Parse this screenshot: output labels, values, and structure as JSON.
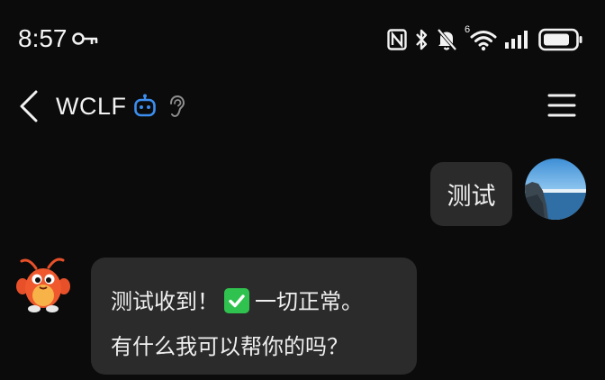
{
  "status_bar": {
    "time": "8:57",
    "icons": [
      "key-icon",
      "nfc-icon",
      "bluetooth-icon",
      "bell-off-icon",
      "wifi-6-icon",
      "signal-icon",
      "battery-icon"
    ],
    "wifi_badge": "6"
  },
  "header": {
    "title": "WCLF",
    "accent_color": "#3b8ef0"
  },
  "messages": [
    {
      "sender": "user",
      "text": "测试"
    },
    {
      "sender": "bot",
      "text_before_emoji": "测试收到！",
      "emoji": "check-mark-button-icon",
      "text_after_emoji": "一切正常。",
      "line2": "有什么我可以帮你的吗？"
    }
  ],
  "colors": {
    "background": "#0b0b0b",
    "bubble": "#2b2b2b",
    "check_green": "#30c24e"
  }
}
